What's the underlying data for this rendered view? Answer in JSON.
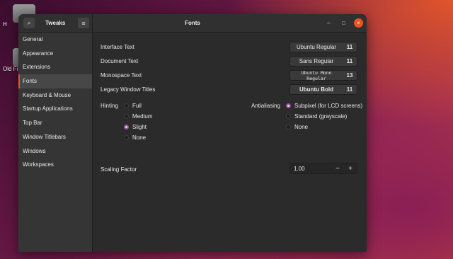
{
  "desktop": {
    "icon_label_1": "H",
    "icon_label_2": "Old Fi"
  },
  "header": {
    "app_title": "Tweaks",
    "window_title": "Fonts",
    "menu_glyph": "≡",
    "search_glyph": "⌕",
    "minimize_glyph": "–",
    "maximize_glyph": "□",
    "close_glyph": "×"
  },
  "sidebar": {
    "items": [
      {
        "label": "General"
      },
      {
        "label": "Appearance"
      },
      {
        "label": "Extensions"
      },
      {
        "label": "Fonts",
        "active": true
      },
      {
        "label": "Keyboard & Mouse"
      },
      {
        "label": "Startup Applications"
      },
      {
        "label": "Top Bar"
      },
      {
        "label": "Window Titlebars"
      },
      {
        "label": "Windows"
      },
      {
        "label": "Workspaces"
      }
    ]
  },
  "fonts": {
    "interface": {
      "label": "Interface Text",
      "font": "Ubuntu Regular",
      "size": "11"
    },
    "document": {
      "label": "Document Text",
      "font": "Sans Regular",
      "size": "11"
    },
    "monospace": {
      "label": "Monospace Text",
      "font": "Ubuntu Mono Regular",
      "size": "13"
    },
    "legacy": {
      "label": "Legacy Window Titles",
      "font": "Ubuntu Bold",
      "size": "11"
    }
  },
  "hinting": {
    "label": "Hinting",
    "options": [
      "Full",
      "Medium",
      "Slight",
      "None"
    ],
    "selected": "Slight"
  },
  "antialiasing": {
    "label": "Antialiasing",
    "options": [
      "Subpixel (for LCD screens)",
      "Standard (grayscale)",
      "None"
    ],
    "selected": "Subpixel (for LCD screens)"
  },
  "scaling": {
    "label": "Scaling Factor",
    "value": "1.00",
    "minus": "−",
    "plus": "+"
  },
  "colors": {
    "accent": "#e95420",
    "radio_selected": "#9d4ca6",
    "window_bg": "#2b2b2b",
    "sidebar_bg": "#353535"
  }
}
